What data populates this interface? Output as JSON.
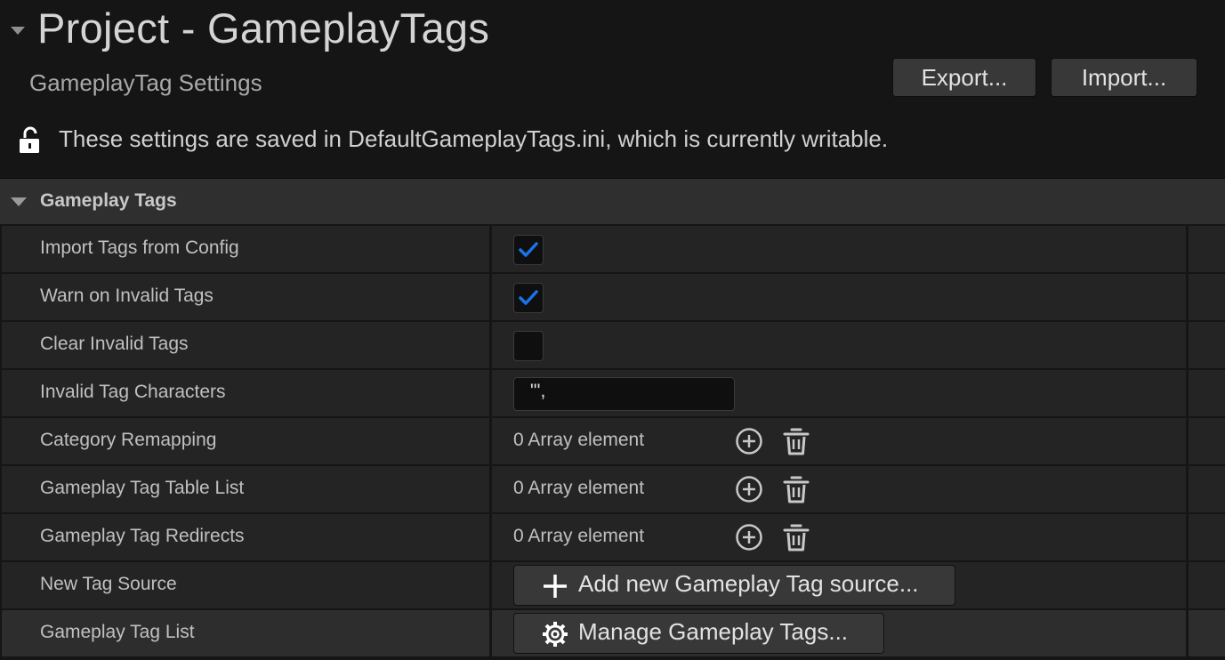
{
  "header": {
    "title": "Project - GameplayTags",
    "subtitle": "GameplayTag Settings",
    "export_label": "Export...",
    "import_label": "Import...",
    "notice": "These settings are saved in DefaultGameplayTags.ini, which is currently writable."
  },
  "category": {
    "label": "Gameplay Tags"
  },
  "properties": {
    "import_tags": {
      "label": "Import Tags from Config",
      "checked": true
    },
    "warn_invalid": {
      "label": "Warn on Invalid Tags",
      "checked": true
    },
    "clear_invalid": {
      "label": "Clear Invalid Tags",
      "checked": false
    },
    "invalid_chars": {
      "label": "Invalid Tag Characters",
      "value": "\"',"
    },
    "category_remapping": {
      "label": "Category Remapping",
      "value": "0 Array element"
    },
    "table_list": {
      "label": "Gameplay Tag Table List",
      "value": "0 Array element"
    },
    "redirects": {
      "label": "Gameplay Tag Redirects",
      "value": "0 Array element"
    },
    "new_tag_source": {
      "label": "New Tag Source",
      "button": "Add new Gameplay Tag source..."
    },
    "tag_list": {
      "label": "Gameplay Tag List",
      "button": "Manage Gameplay Tags..."
    }
  },
  "colors": {
    "check_accent": "#1a73e8",
    "panel_bg": "#151515",
    "row_bg": "#242424",
    "category_bg": "#2f2f2f"
  },
  "icons": {
    "title_toggle": "collapse-arrow-icon",
    "lock": "unlocked-lock-icon",
    "add": "plus-circle-icon",
    "delete": "trash-icon",
    "add_source": "plus-icon",
    "manage": "gear-icon"
  }
}
